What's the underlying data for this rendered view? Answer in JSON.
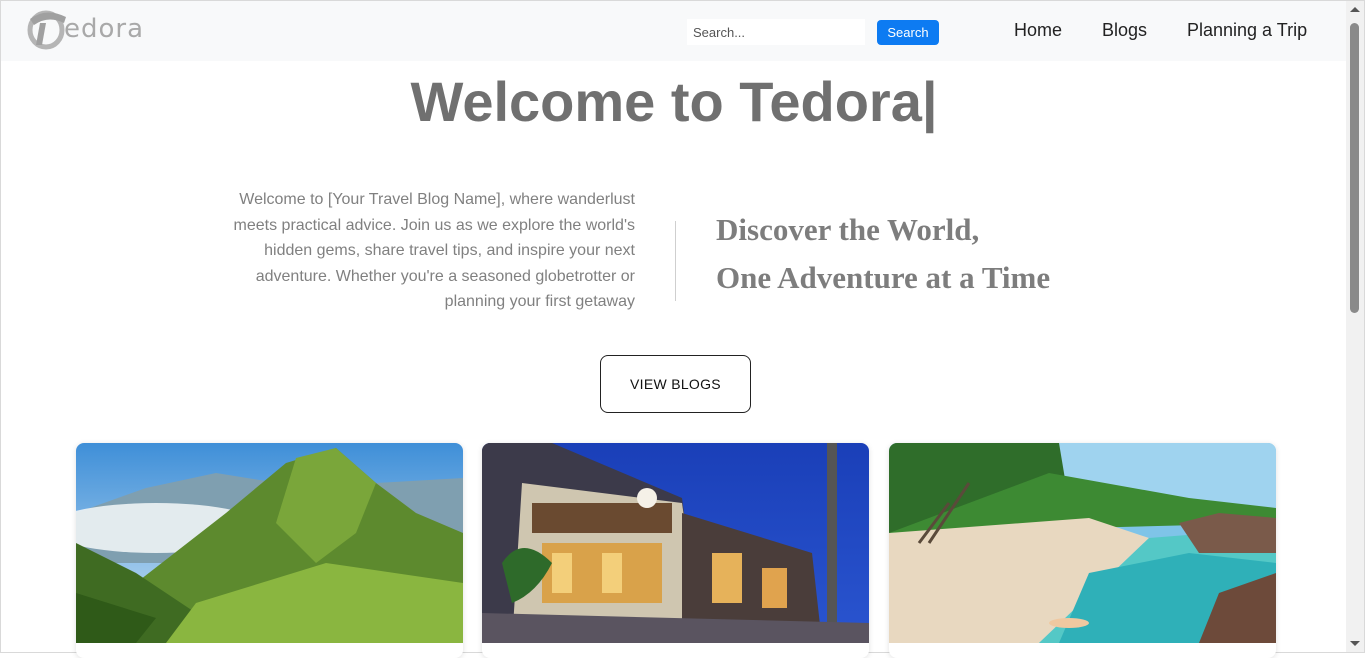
{
  "header": {
    "logo_text": "edora",
    "search": {
      "placeholder": "Search...",
      "button_label": "Search"
    },
    "nav": [
      {
        "label": "Home"
      },
      {
        "label": "Blogs"
      },
      {
        "label": "Planning a Trip"
      }
    ]
  },
  "hero": {
    "title": "Welcome to Tedora|",
    "intro": "Welcome to [Your Travel Blog Name], where wanderlust meets practical advice. Join us as we explore the world's hidden gems, share travel tips, and inspire your next adventure. Whether you're a seasoned globetrotter or planning your first getaway",
    "tagline_line1": "Discover the World,",
    "tagline_line2": "One Adventure at a Time",
    "cta_label": "VIEW BLOGS"
  },
  "cards": [
    {
      "image": "misty-green-mountains-photo"
    },
    {
      "image": "night-street-old-town-photo"
    },
    {
      "image": "tropical-beach-lagoon-photo"
    }
  ],
  "colors": {
    "navbar_bg": "#f8f9fa",
    "search_button": "#0d7bf2",
    "title_gray": "#707070",
    "text_gray": "#808080"
  }
}
